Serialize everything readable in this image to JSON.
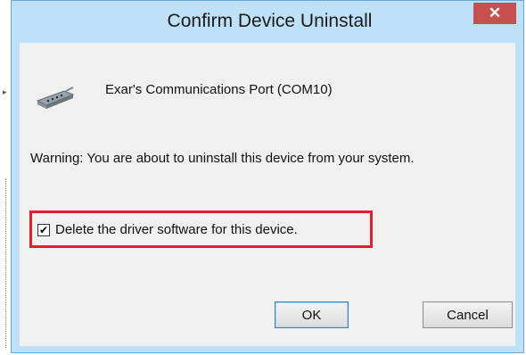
{
  "dialog": {
    "title": "Confirm Device Uninstall",
    "close_label": "✕",
    "device_name": "Exar's Communications Port (COM10)",
    "device_icon": "serial-port-icon",
    "warning_text": "Warning: You are about to uninstall this device from your system.",
    "checkbox": {
      "label": "Delete the driver software for this device.",
      "checked": true,
      "mark": "✔"
    },
    "buttons": {
      "ok": "OK",
      "cancel": "Cancel"
    }
  },
  "colors": {
    "title_bar": "#bfe1f7",
    "close": "#c7504f",
    "highlight": "#e0202e",
    "client": "#f0f0f0"
  }
}
